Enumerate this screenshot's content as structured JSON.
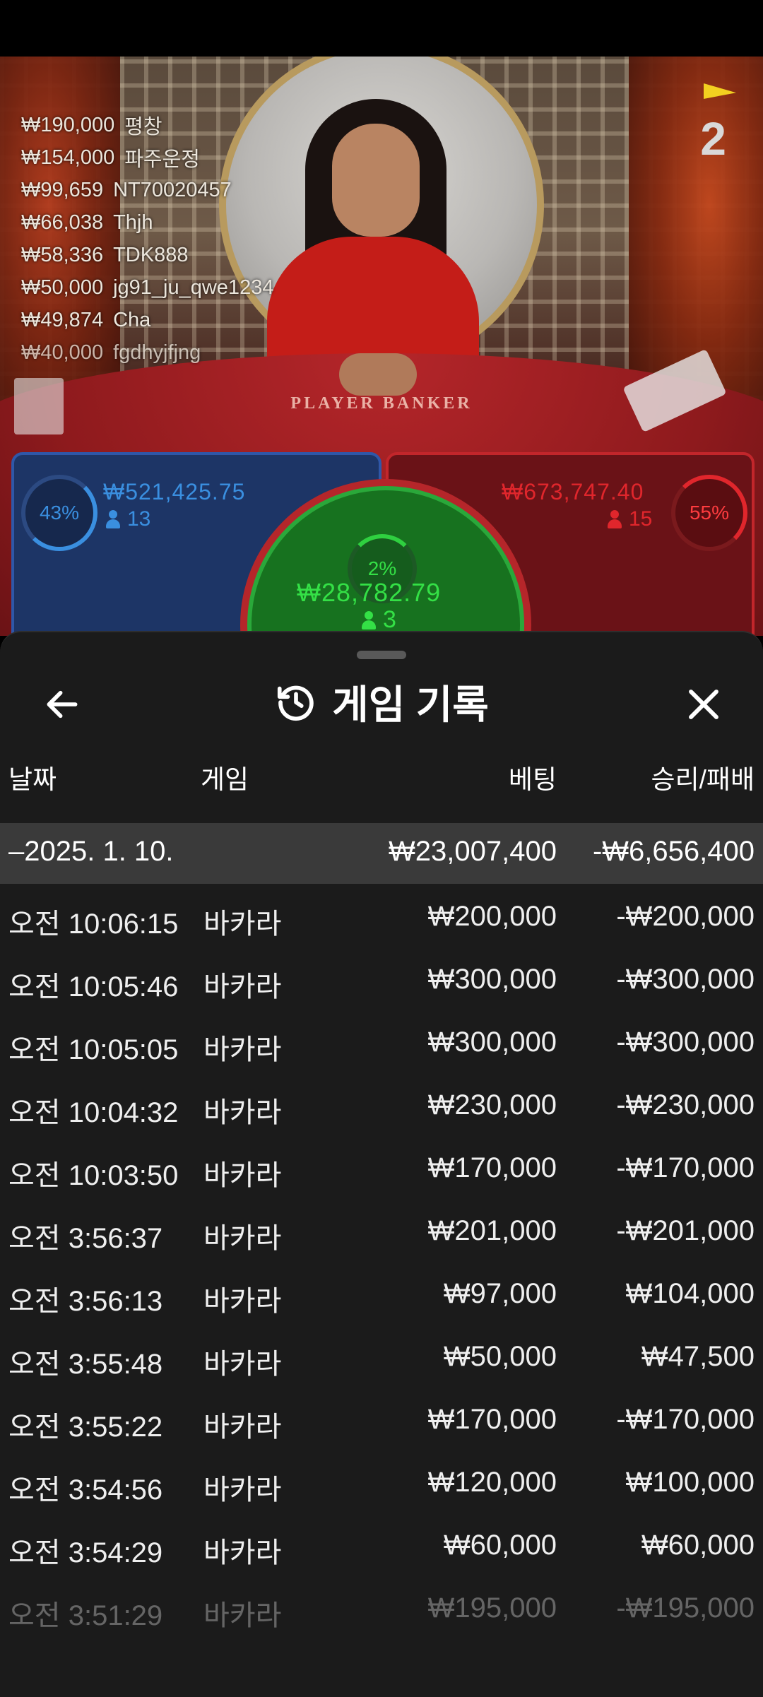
{
  "live_view": {
    "round_number": "2",
    "table_label": "PLAYER      BANKER",
    "leaderboard": [
      {
        "amount": "₩190,000",
        "name": "평창"
      },
      {
        "amount": "₩154,000",
        "name": "파주운정"
      },
      {
        "amount": "₩99,659",
        "name": "NT70020457"
      },
      {
        "amount": "₩66,038",
        "name": "Thjh"
      },
      {
        "amount": "₩58,336",
        "name": "TDK888"
      },
      {
        "amount": "₩50,000",
        "name": "jg91_ju_qwe1234"
      },
      {
        "amount": "₩49,874",
        "name": "Cha"
      },
      {
        "amount": "₩40,000",
        "name": "fgdhyjfjng"
      }
    ],
    "player": {
      "percent": "43%",
      "total": "₩521,425.75",
      "count": "13",
      "color": "#3a8fe0"
    },
    "banker": {
      "percent": "55%",
      "total": "₩673,747.40",
      "count": "15",
      "color": "#e0262c"
    },
    "tie": {
      "percent": "2%",
      "total": "₩28,782.79",
      "count": "3",
      "color": "#34e046"
    }
  },
  "history": {
    "title": "게임 기록",
    "icons": {
      "back": "arrow-left-icon",
      "history": "history-icon",
      "close": "close-icon"
    },
    "columns": {
      "date": "날짜",
      "game": "게임",
      "bet": "베팅",
      "result": "승리/패배"
    },
    "date_group": {
      "label": "–2025. 1. 10.",
      "bet": "₩23,007,400",
      "result": "-₩6,656,400"
    },
    "rows": [
      {
        "time": "오전 10:06:15",
        "game": "바카라",
        "bet": "₩200,000",
        "result": "-₩200,000"
      },
      {
        "time": "오전 10:05:46",
        "game": "바카라",
        "bet": "₩300,000",
        "result": "-₩300,000"
      },
      {
        "time": "오전 10:05:05",
        "game": "바카라",
        "bet": "₩300,000",
        "result": "-₩300,000"
      },
      {
        "time": "오전 10:04:32",
        "game": "바카라",
        "bet": "₩230,000",
        "result": "-₩230,000"
      },
      {
        "time": "오전 10:03:50",
        "game": "바카라",
        "bet": "₩170,000",
        "result": "-₩170,000"
      },
      {
        "time": "오전 3:56:37",
        "game": "바카라",
        "bet": "₩201,000",
        "result": "-₩201,000"
      },
      {
        "time": "오전 3:56:13",
        "game": "바카라",
        "bet": "₩97,000",
        "result": "₩104,000"
      },
      {
        "time": "오전 3:55:48",
        "game": "바카라",
        "bet": "₩50,000",
        "result": "₩47,500"
      },
      {
        "time": "오전 3:55:22",
        "game": "바카라",
        "bet": "₩170,000",
        "result": "-₩170,000"
      },
      {
        "time": "오전 3:54:56",
        "game": "바카라",
        "bet": "₩120,000",
        "result": "₩100,000"
      },
      {
        "time": "오전 3:54:29",
        "game": "바카라",
        "bet": "₩60,000",
        "result": "₩60,000"
      },
      {
        "time": "오전 3:51:29",
        "game": "바카라",
        "bet": "₩195,000",
        "result": "-₩195,000"
      }
    ]
  }
}
